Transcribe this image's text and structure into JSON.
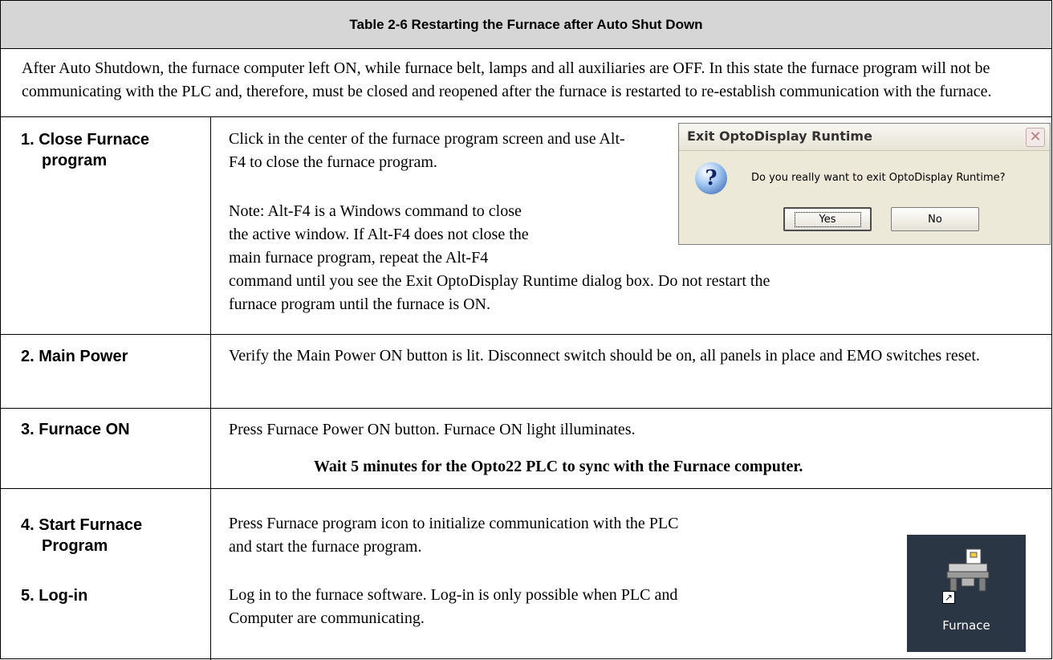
{
  "table": {
    "title": "Table 2-6 Restarting the Furnace after Auto Shut Down",
    "intro": "After Auto Shutdown, the furnace computer left ON, while furnace belt, lamps and all auxiliaries are OFF.  In this state the furnace program will not be communicating with the PLC and, therefore, must be closed and reopened after the furnace is restarted to re-establish communication with the furnace.",
    "steps": [
      {
        "label_line1": "1. Close Furnace",
        "label_line2": "program",
        "text": "Click in the center of the furnace program screen and use Alt-F4 to close the furnace program.",
        "note_line1": "Note: Alt-F4 is a Windows command to close",
        "note_line2": "the active window.  If Alt-F4 does not close the",
        "note_line3": "main furnace program, repeat the Alt-F4",
        "note_line4": "command until you see the Exit OptoDisplay Runtime dialog box.  Do not restart the",
        "note_line5": "furnace program until the furnace is ON."
      },
      {
        "label_line1": "2. Main Power",
        "text": "Verify the Main Power ON button is lit.  Disconnect switch should be on, all panels in place and EMO switches reset."
      },
      {
        "label_line1": "3. Furnace ON",
        "text": "Press Furnace Power ON button. Furnace ON light illuminates.",
        "bold_text": "Wait 5 minutes for the Opto22 PLC to sync with the Furnace computer."
      },
      {
        "label_line1": "4. Start Furnace",
        "label_line2": "Program",
        "text": "Press Furnace program icon to initialize communication with the PLC and start the furnace program."
      },
      {
        "label_line1": "5. Log-in",
        "text": "Log in to the furnace software.  Log-in is only possible when PLC and Computer are communicating."
      }
    ]
  },
  "dialog": {
    "title": "Exit OptoDisplay Runtime",
    "close_glyph": "✕",
    "message": "Do you really want to exit OptoDisplay Runtime?",
    "icon_glyph": "?",
    "yes_label": "Yes",
    "no_label": "No"
  },
  "furnace_icon": {
    "label": "Furnace",
    "shortcut_glyph": "↗"
  }
}
